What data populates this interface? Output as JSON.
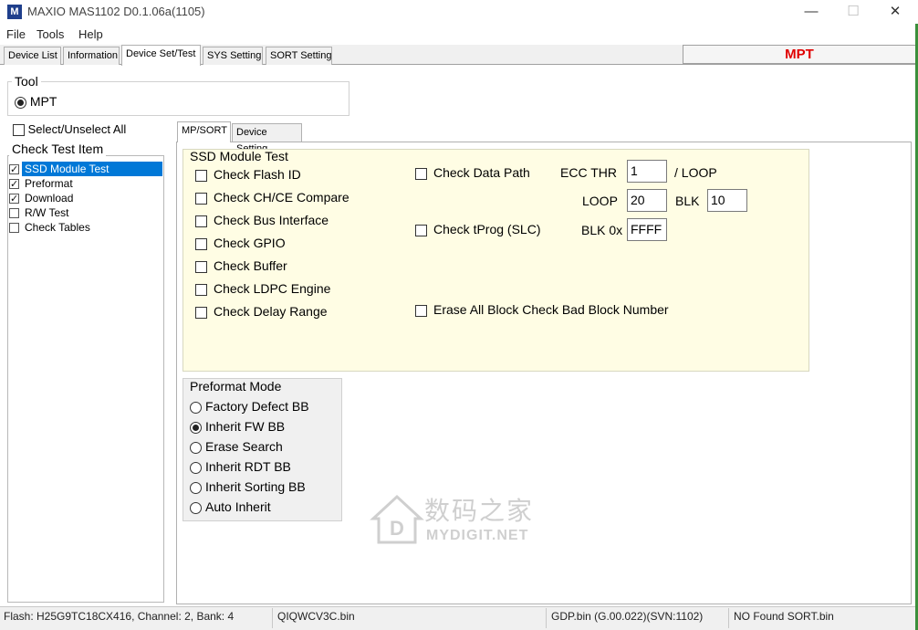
{
  "window": {
    "title": "MAXIO MAS1102 D0.1.06a(1105)",
    "icon_letter": "M",
    "minimize": "—",
    "maximize": "☐",
    "close": "✕"
  },
  "menu": [
    "File",
    "Tools",
    "Help"
  ],
  "top_tabs": [
    "Device List",
    "Information",
    "Device Set/Test",
    "SYS Setting",
    "SORT Setting"
  ],
  "mpt_label": "MPT",
  "tool": {
    "legend": "Tool",
    "option": "MPT"
  },
  "select_all": "Select/Unselect All",
  "check_test": {
    "legend": "Check Test Item",
    "items": [
      {
        "label": "SSD Module Test",
        "checked": true
      },
      {
        "label": "Preformat",
        "checked": true
      },
      {
        "label": "Download",
        "checked": true
      },
      {
        "label": "R/W Test",
        "checked": false
      },
      {
        "label": "Check Tables",
        "checked": false
      }
    ]
  },
  "inner_tabs": [
    "MP/SORT",
    "Device Setting"
  ],
  "ssd": {
    "legend": "SSD Module Test",
    "left_checks": [
      "Check Flash ID",
      "Check CH/CE Compare",
      "Check Bus Interface",
      "Check GPIO",
      "Check Buffer",
      "Check LDPC Engine",
      "Check Delay Range"
    ],
    "check_data_path": "Check Data Path",
    "ecc_thr_label": "ECC THR",
    "ecc_thr_value": "1",
    "per_loop": "/ LOOP",
    "loop_label": "LOOP",
    "loop_value": "20",
    "blk_label": "BLK",
    "blk_value": "10",
    "check_tprog": "Check tProg (SLC)",
    "blk0x_label": "BLK 0x",
    "blk0x_value": "FFFF",
    "erase_all": "Erase All Block Check Bad Block Number"
  },
  "preformat": {
    "legend": "Preformat Mode",
    "options": [
      {
        "label": "Factory Defect BB",
        "selected": false
      },
      {
        "label": "Inherit FW BB",
        "selected": true
      },
      {
        "label": "Erase Search",
        "selected": false
      },
      {
        "label": "Inherit RDT BB",
        "selected": false
      },
      {
        "label": "Inherit Sorting BB",
        "selected": false
      },
      {
        "label": "Auto Inherit",
        "selected": false
      }
    ]
  },
  "watermark": {
    "cn": "数码之家",
    "en": "MYDIGIT.NET"
  },
  "status": {
    "flash": "Flash: H25G9TC18CX416, Channel: 2, Bank: 4",
    "qi": "QIQWCV3C.bin",
    "gdp": "GDP.bin (G.00.022)(SVN:1102)",
    "sort": "NO Found SORT.bin"
  }
}
